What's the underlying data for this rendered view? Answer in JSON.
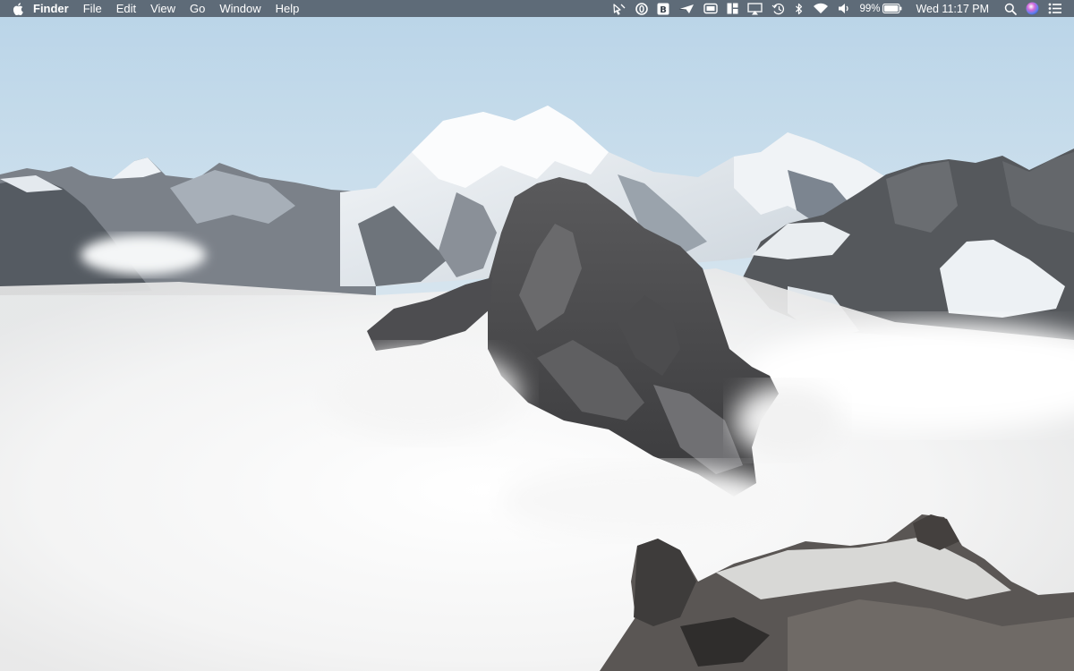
{
  "menubar": {
    "apple_icon": "apple-logo-icon",
    "app_name": "Finder",
    "menus": [
      "File",
      "Edit",
      "View",
      "Go",
      "Window",
      "Help"
    ],
    "status_icons": [
      "script-cursor-icon",
      "opera-circle-icon",
      "bold-b-icon",
      "paper-plane-icon",
      "window-stack-icon",
      "grid-layout-icon",
      "airplay-icon",
      "time-machine-icon",
      "bluetooth-icon",
      "wifi-icon",
      "volume-icon"
    ],
    "battery_percent": "99%",
    "battery_level": 0.99,
    "clock": "Wed 11:17 PM",
    "right_icons": [
      "spotlight-search-icon",
      "siri-icon",
      "notification-center-icon"
    ]
  },
  "colors": {
    "menubar_bg": "#3a424c",
    "sky": "#c3dbec",
    "fog": "#f4f4f4",
    "rock": "#4a4a4a",
    "snow": "#eef2f5"
  }
}
